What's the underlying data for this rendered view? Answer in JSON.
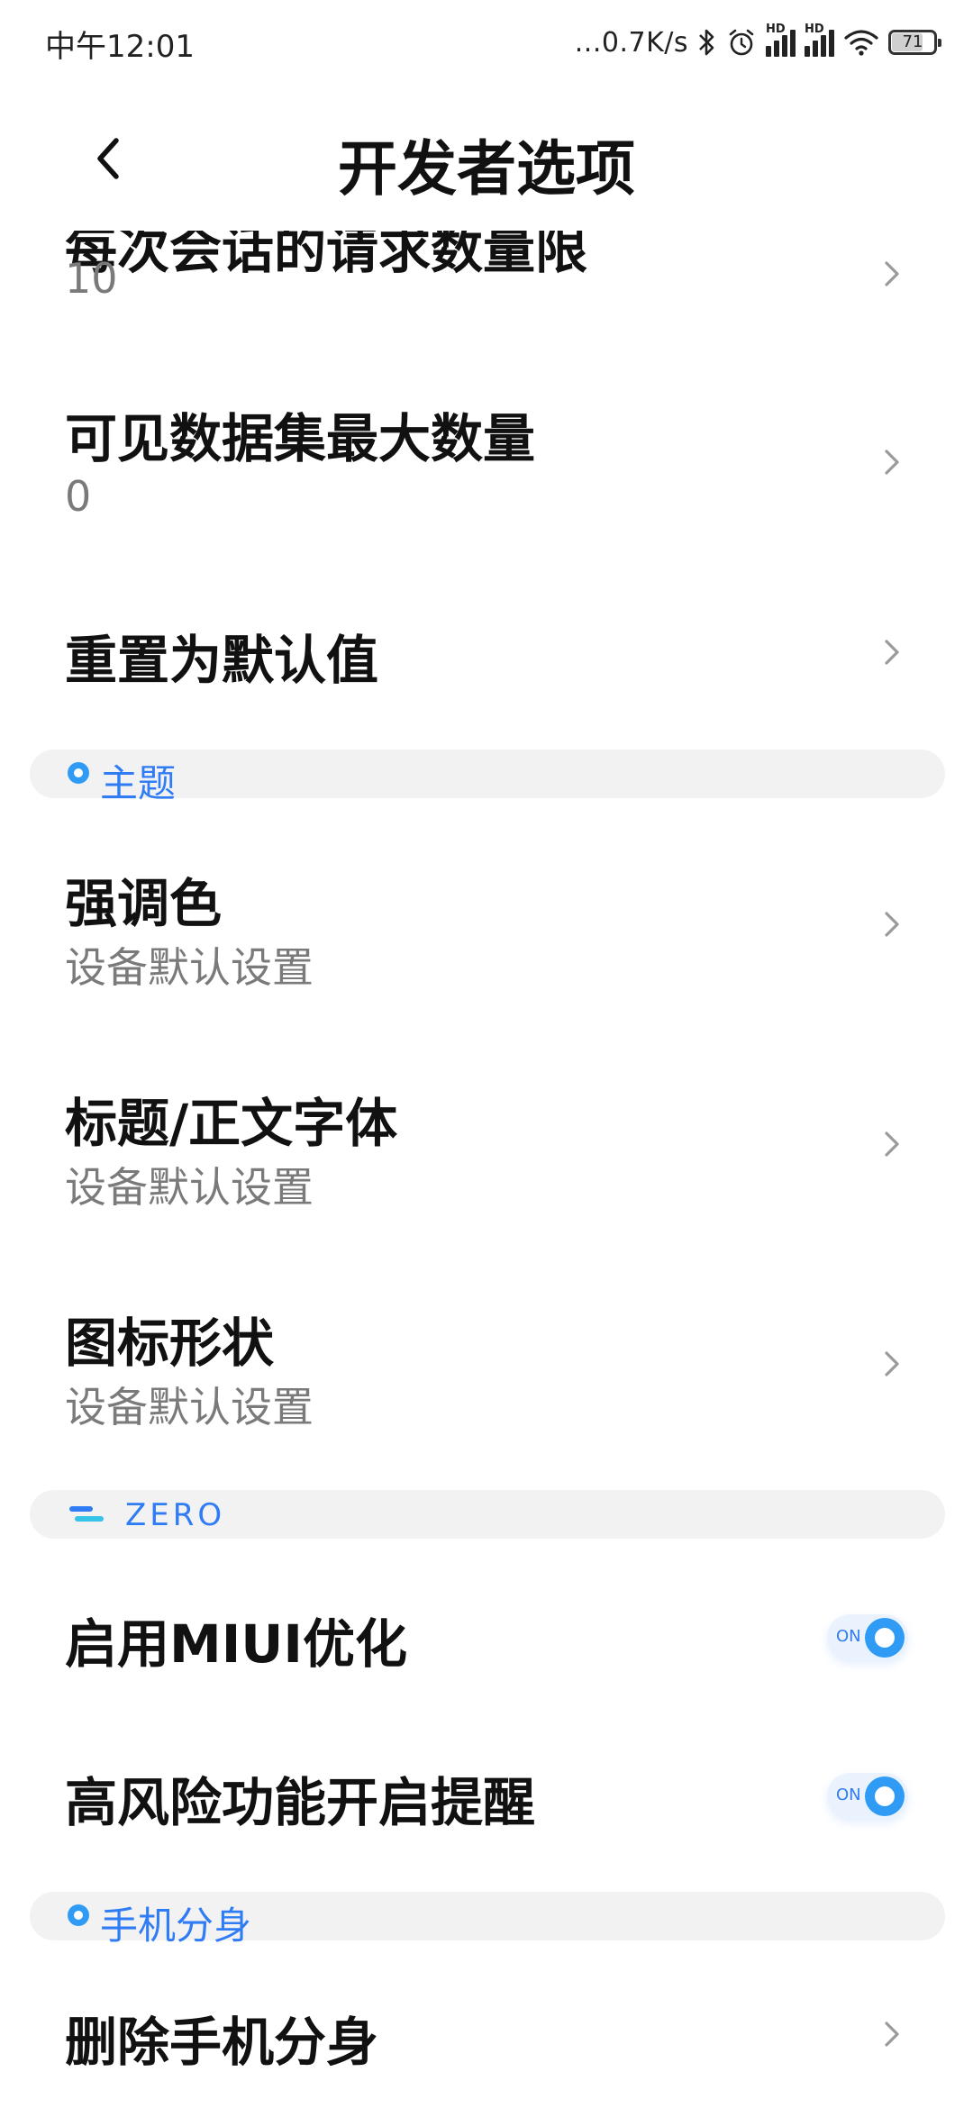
{
  "status_bar": {
    "time": "中午12:01",
    "network_speed": "...0.7K/s",
    "signal_hd_1": "HD",
    "signal_hd_2": "HD",
    "battery_level": "71"
  },
  "header": {
    "title": "开发者选项"
  },
  "rows": [
    {
      "id": "truncated-setting",
      "title": "每次会话的请求数量限",
      "value": "10",
      "type": "chevron"
    },
    {
      "id": "max-visible-datasets",
      "title": "可见数据集最大数量",
      "value": "0",
      "type": "chevron"
    },
    {
      "id": "reset-default",
      "title": "重置为默认值",
      "value": "",
      "type": "chevron"
    }
  ],
  "section_theme": {
    "label": "主题"
  },
  "theme_rows": [
    {
      "id": "accent-color",
      "title": "强调色",
      "value": "设备默认设置"
    },
    {
      "id": "header-body-font",
      "title": "标题/正文字体",
      "value": "设备默认设置"
    },
    {
      "id": "icon-shape",
      "title": "图标形状",
      "value": "设备默认设置"
    }
  ],
  "section_zero": {
    "label": "ZERO"
  },
  "toggle_rows": [
    {
      "id": "miui-optimization",
      "title": "启用MIUI优化",
      "state_label": "ON",
      "enabled": true
    },
    {
      "id": "high-risk-reminder",
      "title": "高风险功能开启提醒",
      "state_label": "ON",
      "enabled": true
    }
  ],
  "section_clone": {
    "label": "手机分身"
  },
  "clone_rows": [
    {
      "id": "delete-second-space",
      "title": "删除手机分身",
      "value": ""
    }
  ],
  "colors": {
    "accent": "#2f7cf5",
    "section_bg": "#f2f2f2",
    "subtitle": "#7a7a7a"
  }
}
